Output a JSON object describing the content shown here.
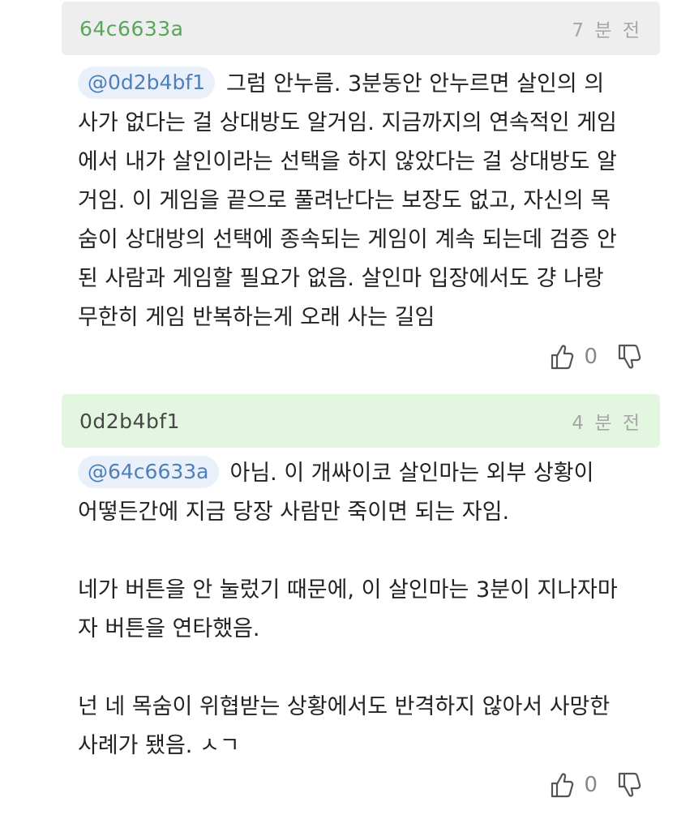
{
  "comments": [
    {
      "author": "64c6633a",
      "time": "7 분 전",
      "mention": "@0d2b4bf1",
      "lines": [
        "그럼 안누름. 3분동안 안누르면 살인의 의",
        "사가 없다는 걸 상대방도 알거임. 지금까지의 연속적인 게임",
        "에서 내가 살인이라는 선택을 하지 않았다는 걸 상대방도 알",
        "거임. 이 게임을 끝으로 풀려난다는 보장도 없고, 자신의 목",
        "숨이 상대방의 선택에 종속되는 게임이 계속 되는데 검증 안",
        "된 사람과 게임할 필요가 없음. 살인마 입장에서도 걍 나랑",
        "무한히 게임 반복하는게 오래 사는 길임"
      ],
      "likes": "0",
      "like_icon": "thumbs-up-icon",
      "dislike_icon": "thumbs-down-icon"
    },
    {
      "author": "0d2b4bf1",
      "time": "4 분 전",
      "mention": "@64c6633a",
      "lines": [
        "아님. 이 개싸이코 살인마는 외부 상황이",
        "어떻든간에 지금 당장 사람만 죽이면 되는 자임.",
        "",
        "네가 버튼을 안 눌렀기 때문에, 이 살인마는 3분이 지나자마",
        "자 버튼을 연타했음.",
        "",
        "넌 네 목숨이 위협받는 상황에서도 반격하지 않아서 사망한",
        "사례가 됐음. ㅅㄱ"
      ],
      "likes": "0",
      "like_icon": "thumbs-up-icon",
      "dislike_icon": "thumbs-down-icon"
    }
  ]
}
